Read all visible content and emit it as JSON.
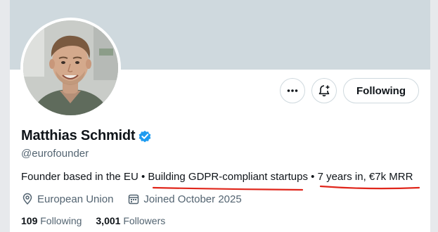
{
  "profile": {
    "name": "Matthias Schmidt",
    "handle": "@eurofounder",
    "bio": {
      "part1": "Founder based in the EU",
      "sep1": " • ",
      "part2": "Building GDPR-compliant startups",
      "sep2": " • ",
      "part3": "7 years in, €7k MRR"
    },
    "location": "European Union",
    "joined": "Joined October 2025",
    "following_count": "109",
    "following_label": "Following",
    "followers_count": "3,001",
    "followers_label": "Followers"
  },
  "actions": {
    "more_icon": "more-horizontal-icon",
    "notify_icon": "bell-plus-icon",
    "follow_label": "Following"
  },
  "colors": {
    "verified": "#1d9bf0",
    "annotation": "#e0261b",
    "banner": "#cfd9de",
    "muted_text": "#536471"
  }
}
